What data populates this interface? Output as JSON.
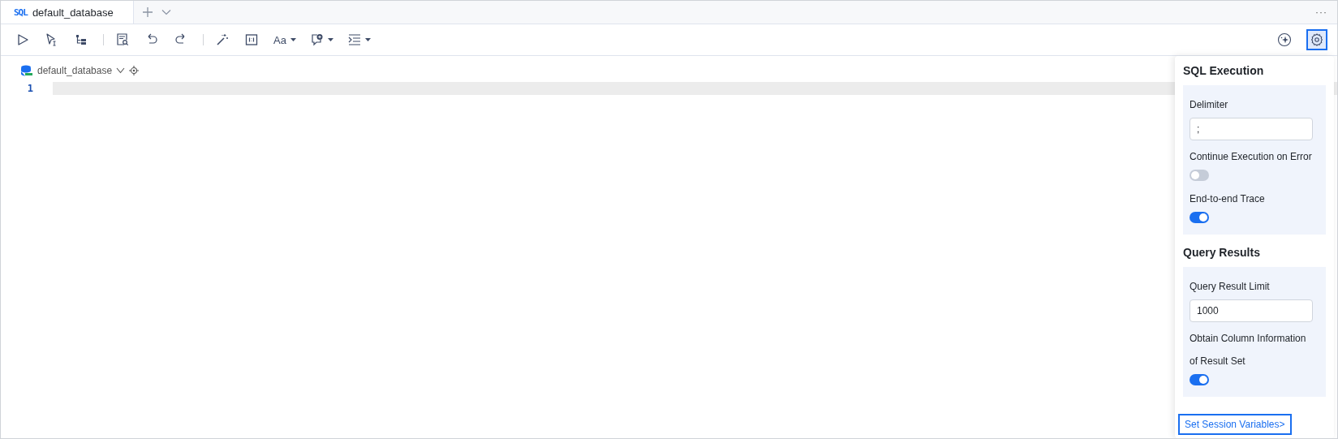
{
  "tabs": [
    {
      "badge": "SQL",
      "label": "default_database",
      "selected": true
    }
  ],
  "more_menu": "···",
  "toolbar": [
    [
      {
        "kind": "run"
      },
      {
        "kind": "run-selected"
      },
      {
        "kind": "plan"
      }
    ],
    [
      {
        "kind": "review"
      },
      {
        "kind": "undo"
      },
      {
        "kind": "redo"
      }
    ],
    [
      {
        "kind": "beautify"
      },
      {
        "kind": "format"
      },
      {
        "kind": "font",
        "label": "Aa"
      },
      {
        "kind": "comment"
      },
      {
        "kind": "indent"
      }
    ]
  ],
  "toolbar_right": [
    {
      "kind": "assistant",
      "selected": false
    },
    {
      "kind": "settings",
      "selected": true
    }
  ],
  "breadcrumb": {
    "database": "default_database"
  },
  "editor": {
    "lines": [
      {
        "number": "1",
        "current": true
      }
    ]
  },
  "settings_panel": {
    "sections": [
      {
        "title": "SQL Execution",
        "fields": [
          {
            "kind": "input",
            "label": "Delimiter",
            "value": ";"
          },
          {
            "kind": "toggle",
            "label": "Continue Execution on Error",
            "on": false
          },
          {
            "kind": "toggle",
            "label": "End-to-end Trace",
            "on": true
          }
        ]
      },
      {
        "title": "Query Results",
        "fields": [
          {
            "kind": "input",
            "label": "Query Result Limit",
            "value": "1000"
          },
          {
            "kind": "toggle",
            "label": "Obtain Column Information of Result Set",
            "on": true
          }
        ]
      }
    ],
    "link": "Set Session Variables>"
  }
}
